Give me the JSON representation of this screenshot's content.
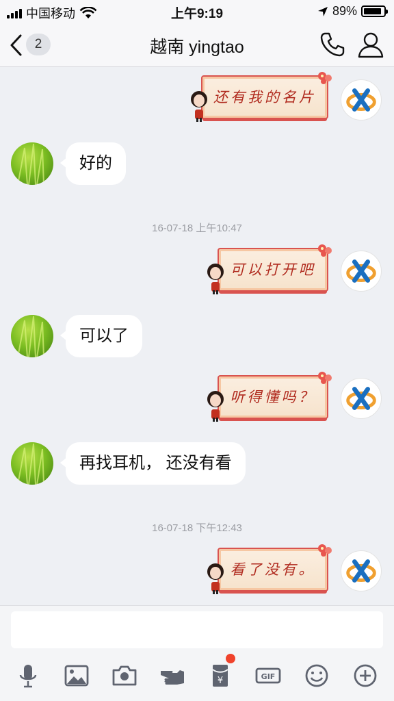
{
  "status_bar": {
    "carrier": "中国移动",
    "time": "上午9:19",
    "battery_text": "89%",
    "battery_level": 0.89
  },
  "nav": {
    "back_icon": "chevron-left-icon",
    "unread_count": "2",
    "title": "越南 yingtao",
    "phone_icon": "phone-icon",
    "profile_icon": "person-icon"
  },
  "messages": [
    {
      "side": "right",
      "type": "sticker",
      "text": "还有我的名片"
    },
    {
      "side": "left",
      "type": "text",
      "text": "好的"
    },
    {
      "type": "timestamp",
      "text": "16-07-18 上午10:47"
    },
    {
      "side": "right",
      "type": "sticker",
      "text": "可以打开吧"
    },
    {
      "side": "left",
      "type": "text",
      "text": "可以了"
    },
    {
      "side": "right",
      "type": "sticker",
      "text": "听得懂吗？"
    },
    {
      "side": "left",
      "type": "text",
      "text": "再找耳机， 还没有看"
    },
    {
      "type": "timestamp",
      "text": "16-07-18 下午12:43"
    },
    {
      "side": "right",
      "type": "sticker",
      "text": "看了没有。"
    }
  ],
  "input": {
    "value": "",
    "placeholder": ""
  },
  "toolbar": {
    "items": [
      "microphone-icon",
      "image-icon",
      "camera-icon",
      "poke-hand-icon",
      "red-packet-icon",
      "gif-icon",
      "emoji-icon",
      "plus-icon"
    ],
    "red_packet_has_badge": true
  },
  "colors": {
    "background": "#eef0f4",
    "bubble": "#ffffff",
    "sticker_red": "#b02a1e",
    "badge_red": "#f0432c"
  }
}
